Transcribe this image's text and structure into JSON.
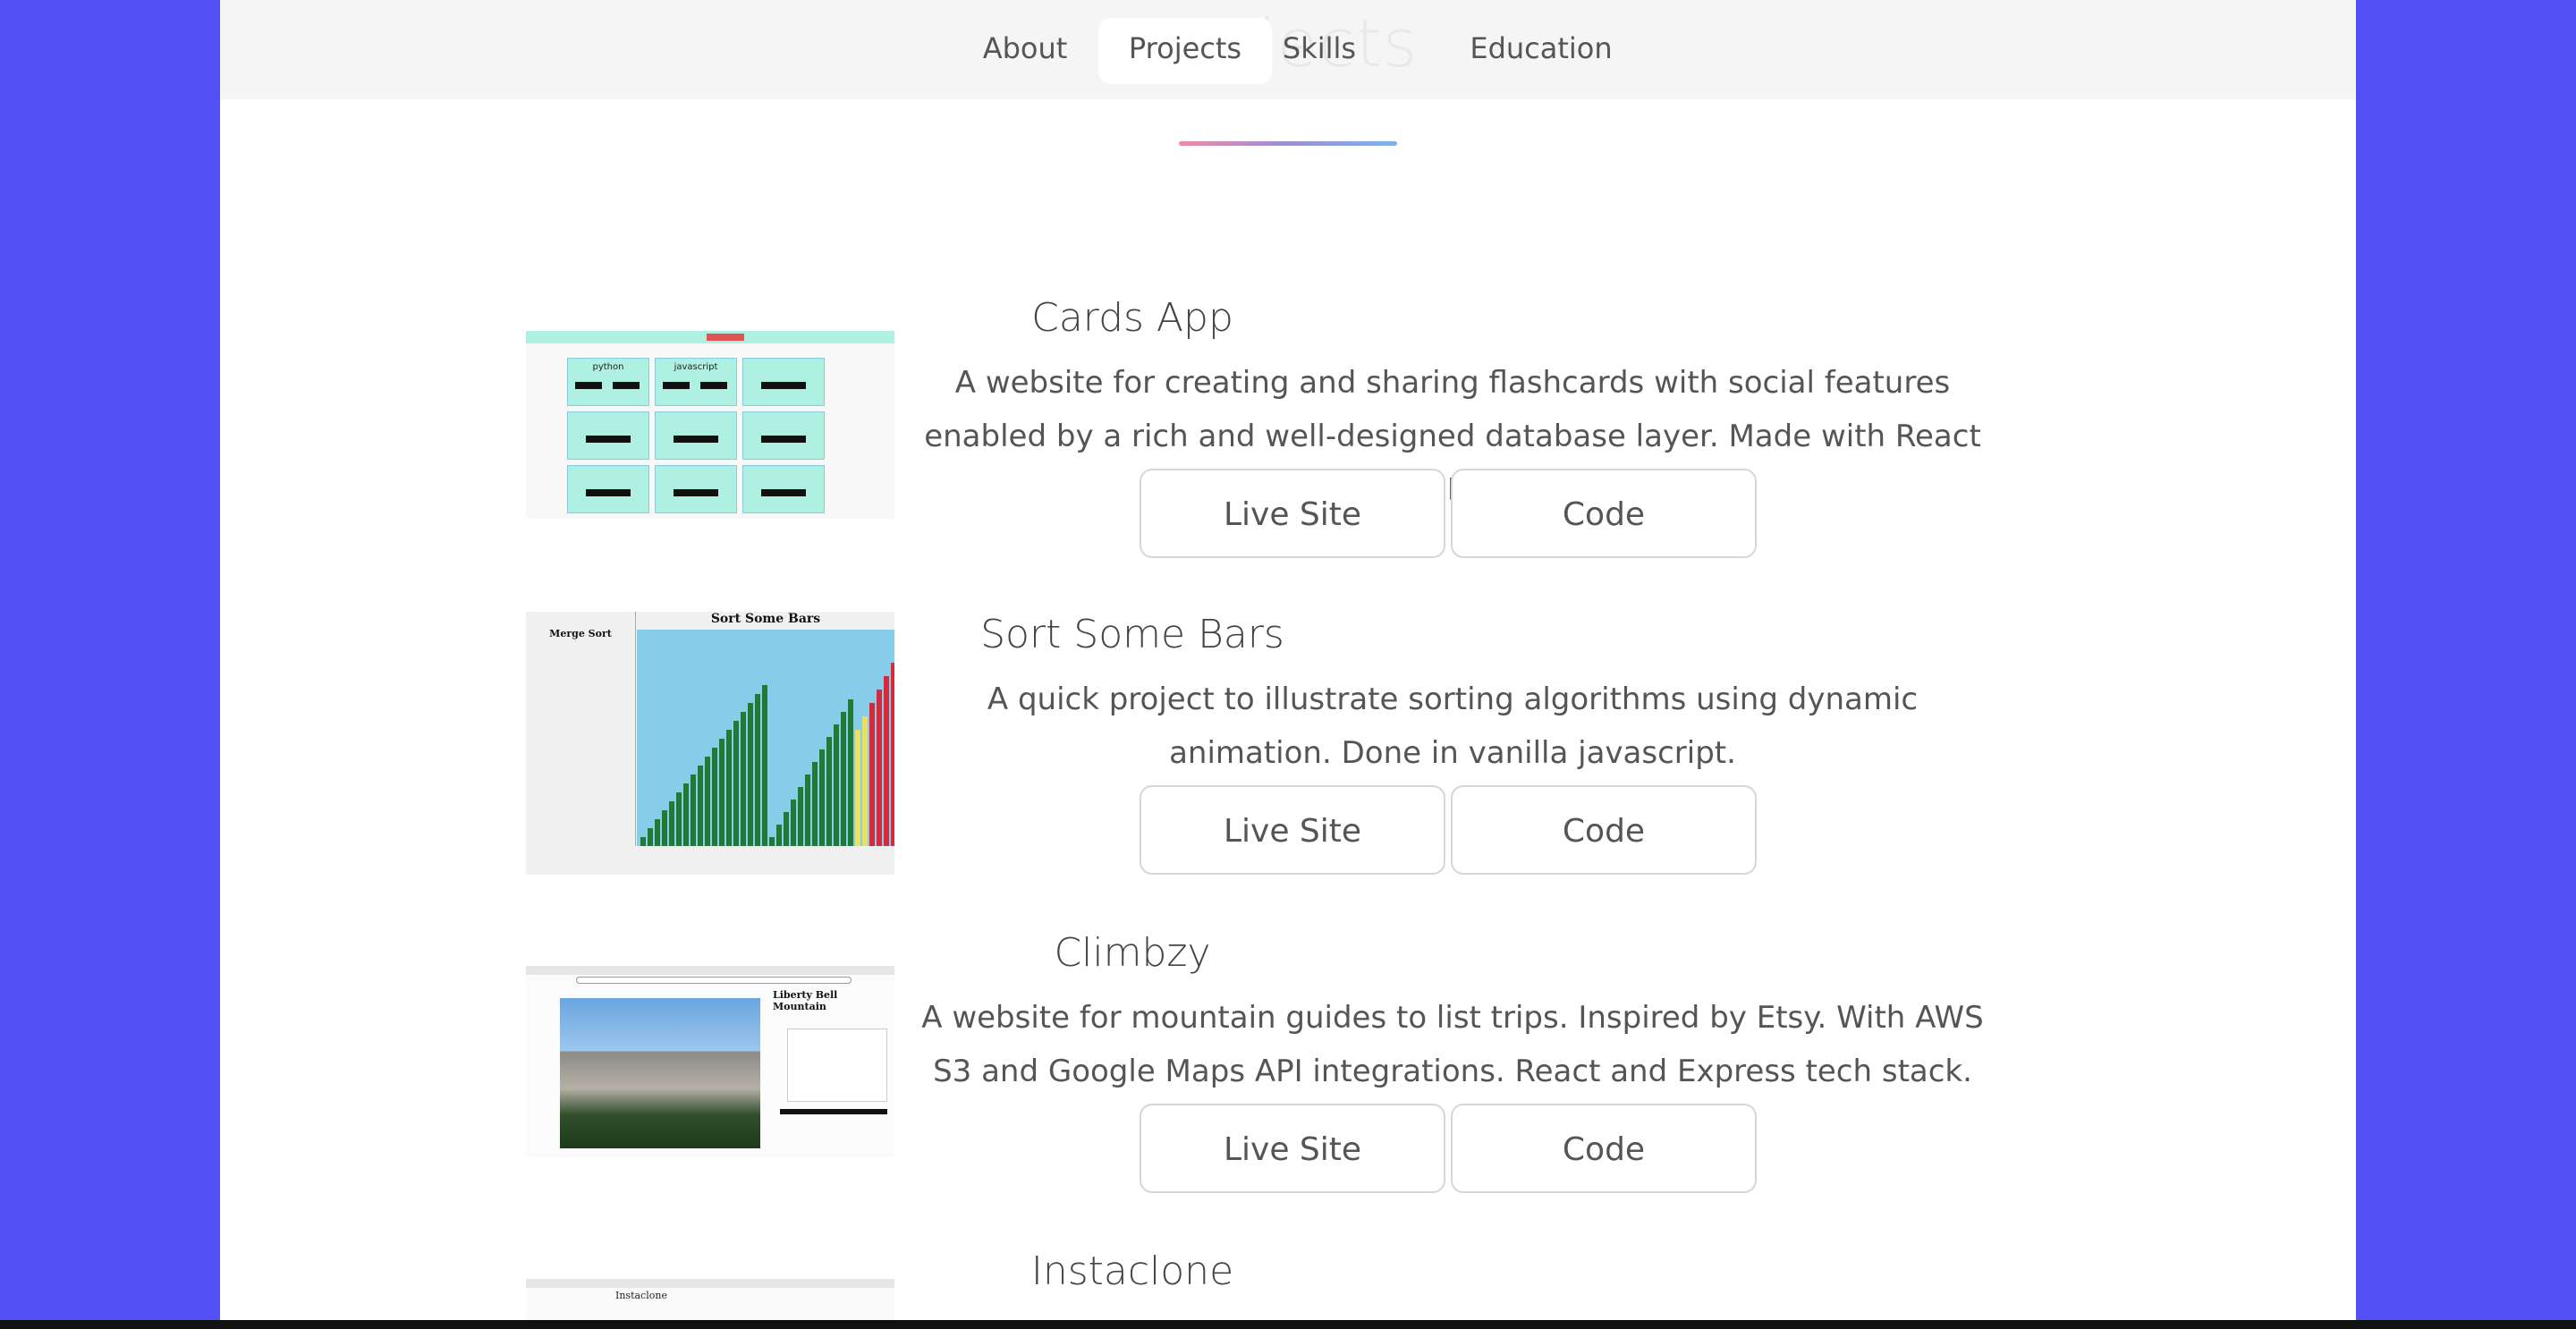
{
  "nav": {
    "items": [
      {
        "label": "About"
      },
      {
        "label": "Projects",
        "active": true
      },
      {
        "label": "Skills"
      },
      {
        "label": "Education"
      }
    ],
    "ghost_title": "jects"
  },
  "projects": [
    {
      "title": "Cards App",
      "description": "A website for creating and sharing flashcards with social features enabled by a rich and well-designed database layer. Made with React and Flask",
      "buttons": {
        "live": "Live Site",
        "code": "Code"
      },
      "thumb": {
        "cards": [
          "python",
          "javascript"
        ]
      }
    },
    {
      "title": "Sort Some Bars",
      "description": "A quick project to illustrate sorting algorithms using dynamic animation. Done in vanilla javascript.",
      "buttons": {
        "live": "Live Site",
        "code": "Code"
      },
      "thumb": {
        "heading": "Sort Some Bars",
        "side_title": "Merge Sort"
      }
    },
    {
      "title": "Climbzy",
      "description": "A website for mountain guides to list trips. Inspired by Etsy. With AWS S3 and Google Maps API integrations. React and Express tech stack.",
      "buttons": {
        "live": "Live Site",
        "code": "Code"
      },
      "thumb": {
        "heading": "Liberty Bell Mountain"
      }
    },
    {
      "title": "Instaclone",
      "description": "",
      "thumb": {
        "heading": "Instaclone"
      }
    }
  ],
  "colors": {
    "background": "#5151f5",
    "accent_gradient": [
      "#ef8aa6",
      "#7fb1ee"
    ]
  }
}
